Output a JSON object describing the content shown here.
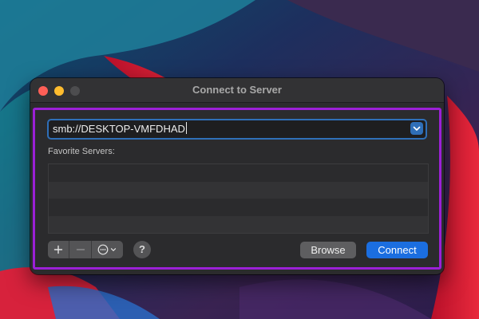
{
  "window": {
    "title": "Connect to Server"
  },
  "server_address": {
    "value": "smb://DESKTOP-VMFDHAD",
    "dropdown_icon": "chevron-down-icon"
  },
  "favorites": {
    "label": "Favorite Servers:",
    "rows": [
      "",
      "",
      "",
      ""
    ]
  },
  "toolbar": {
    "add_icon": "plus-icon",
    "remove_icon": "minus-icon",
    "actions_icon": "ellipsis-circle-icon",
    "help_label": "?",
    "browse_label": "Browse",
    "connect_label": "Connect"
  },
  "colors": {
    "accent": "#1b6ee0",
    "highlight_border": "#9b20d6",
    "window_bg": "#2b2b2d"
  }
}
